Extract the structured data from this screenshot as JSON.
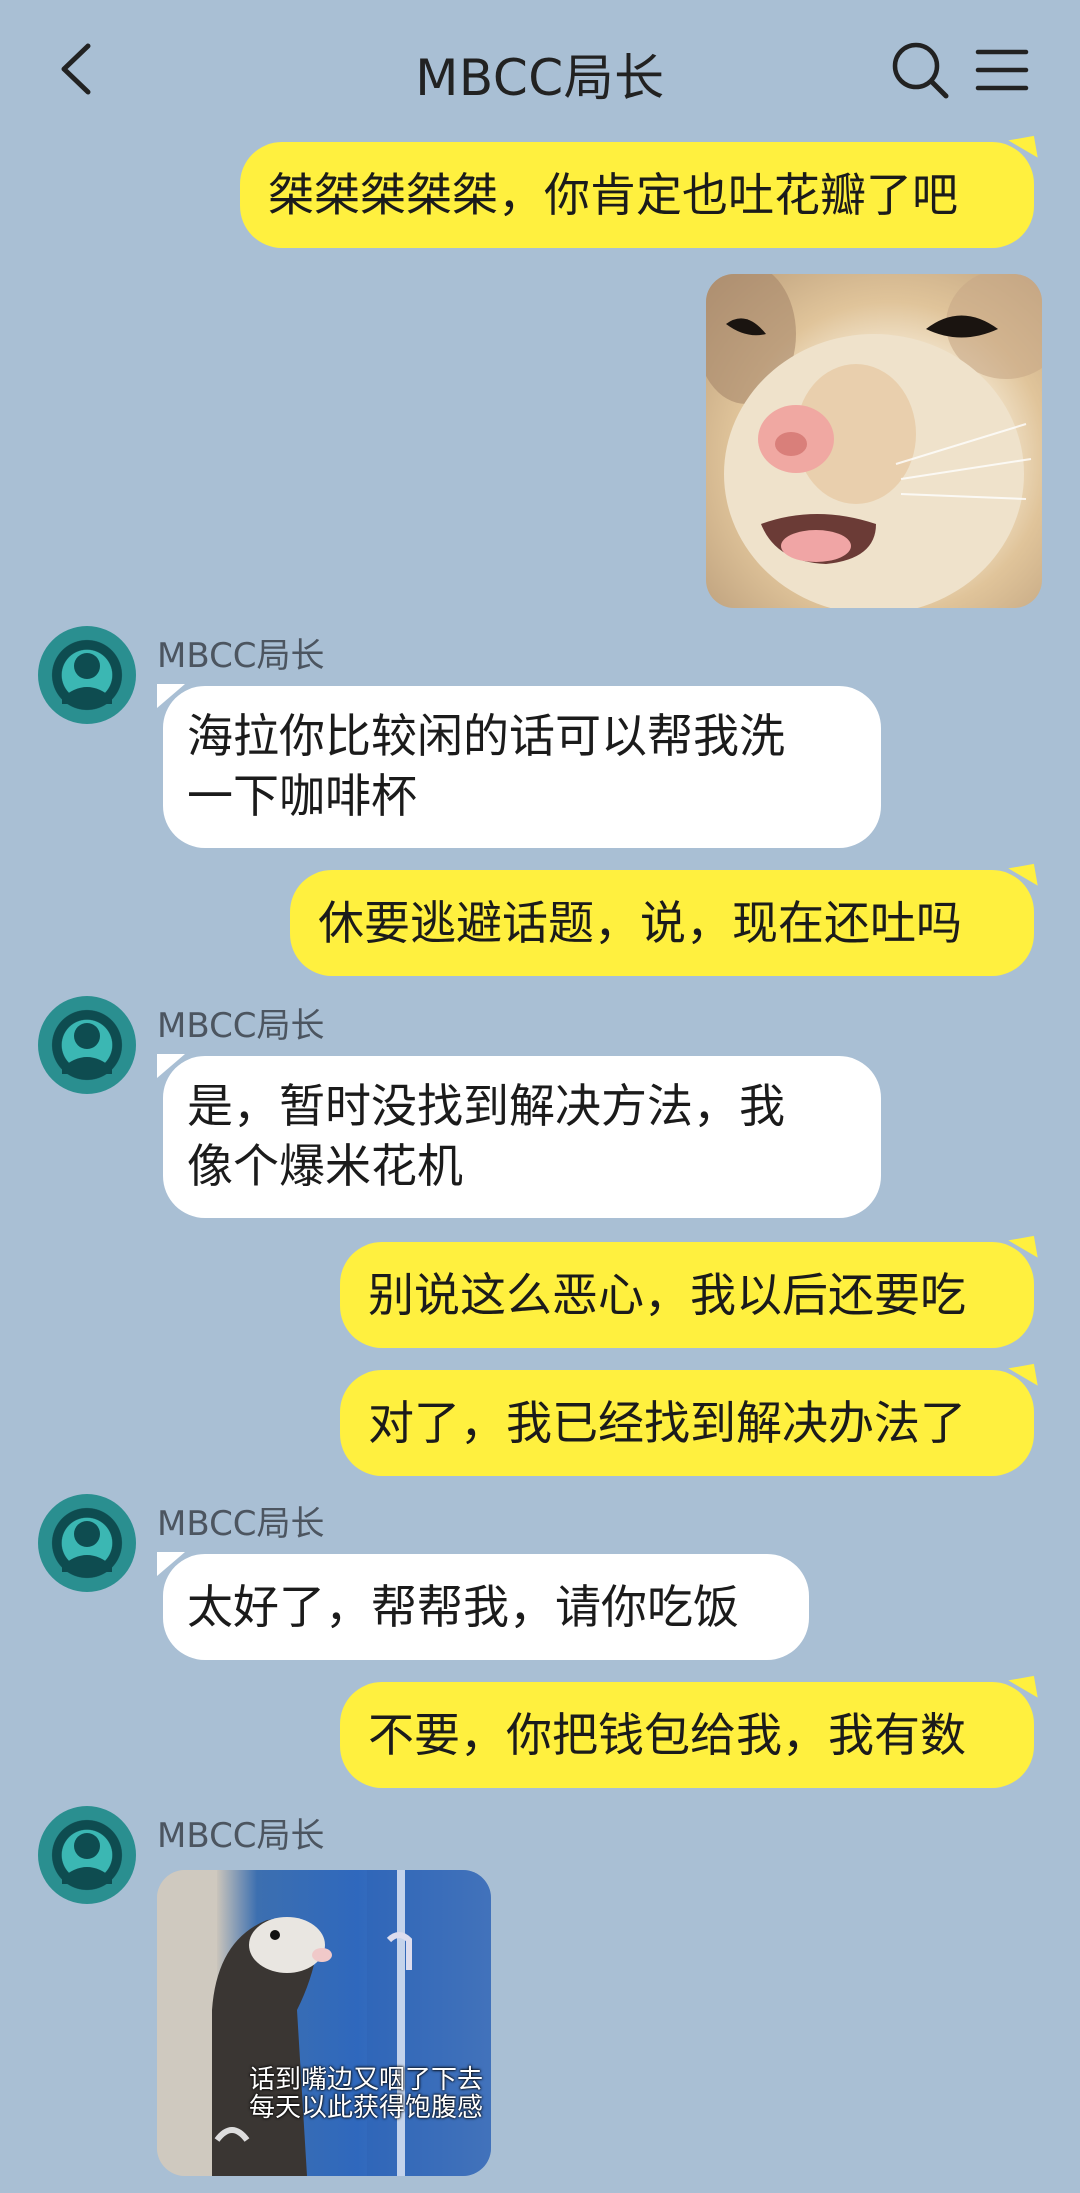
{
  "header": {
    "title": "MBCC局长"
  },
  "messages": [
    {
      "type": "text",
      "from": "me",
      "text": "桀桀桀桀桀，你肯定也吐花瓣了吧"
    },
    {
      "type": "image",
      "from": "me",
      "description_icon": "cat-face-sticker"
    },
    {
      "type": "text",
      "from": "them",
      "sender": "MBCC局长",
      "lines": [
        "海拉你比较闲的话可以帮我洗",
        "一下咖啡杯"
      ]
    },
    {
      "type": "text",
      "from": "me",
      "text": "休要逃避话题，说，现在还吐吗"
    },
    {
      "type": "text",
      "from": "them",
      "sender": "MBCC局长",
      "lines": [
        "是，暂时没找到解决方法，我",
        "像个爆米花机"
      ]
    },
    {
      "type": "text",
      "from": "me",
      "text": "别说这么恶心，我以后还要吃"
    },
    {
      "type": "text",
      "from": "me",
      "text": "对了，我已经找到解决办法了"
    },
    {
      "type": "text",
      "from": "them",
      "sender": "MBCC局长",
      "text": "太好了，帮帮我，请你吃饭"
    },
    {
      "type": "text",
      "from": "me",
      "text": "不要，你把钱包给我，我有数"
    },
    {
      "type": "image",
      "from": "them",
      "sender": "MBCC局长",
      "caption_lines": [
        "话到嘴边又咽了下去",
        "每天以此获得饱腹感"
      ]
    }
  ],
  "colors": {
    "background": "#a9bfd4",
    "my_bubble": "#fff03f",
    "their_bubble": "#ffffff"
  }
}
